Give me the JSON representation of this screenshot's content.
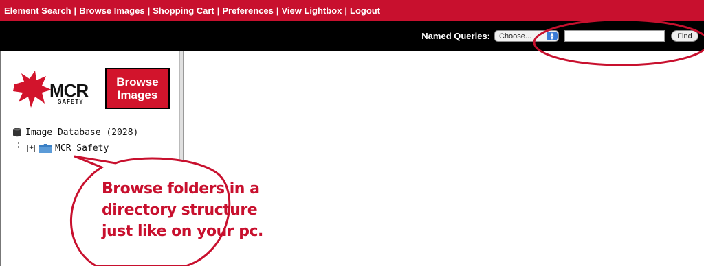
{
  "nav": {
    "items": [
      {
        "label": "Element Search"
      },
      {
        "label": "Browse Images"
      },
      {
        "label": "Shopping Cart"
      },
      {
        "label": "Preferences"
      },
      {
        "label": "View Lightbox"
      },
      {
        "label": "Logout"
      }
    ],
    "separator": "|"
  },
  "query_bar": {
    "label": "Named Queries:",
    "select_value": "Choose...",
    "input_value": "",
    "find_label": "Find"
  },
  "logo": {
    "brand_text": "MCR",
    "brand_sub": "SAFETY",
    "badge_text": "Browse\nImages"
  },
  "tree": {
    "root_label": "Image Database (2028)",
    "children": [
      {
        "label": "MCR Safety",
        "expander": "+"
      }
    ]
  },
  "callout": {
    "lines": [
      "Browse folders in a",
      "directory structure",
      "just like on your pc."
    ]
  },
  "colors": {
    "nav_red": "#c8102e",
    "callout_red": "#c8102e",
    "query_bar_bg": "#000000"
  }
}
